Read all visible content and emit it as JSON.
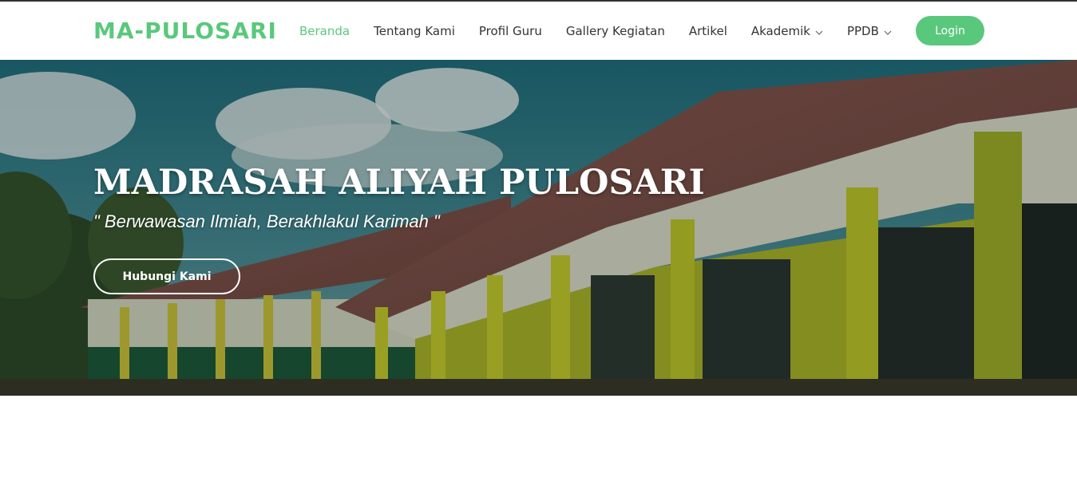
{
  "brand": {
    "logo": "MA-PULOSARI",
    "accent_color": "#5ac87c"
  },
  "nav": {
    "items": [
      {
        "label": "Beranda",
        "active": true
      },
      {
        "label": "Tentang Kami"
      },
      {
        "label": "Profil Guru"
      },
      {
        "label": "Gallery Kegiatan"
      },
      {
        "label": "Artikel"
      },
      {
        "label": "Akademik",
        "icon": "chevron-down-icon"
      },
      {
        "label": "PPDB",
        "icon": "chevron-down-icon"
      }
    ],
    "login_label": "Login"
  },
  "hero": {
    "title": "MADRASAH ALIYAH PULOSARI",
    "subtitle": "\" Berwawasan Ilmiah, Berakhlakul Karimah \"",
    "button_label": "Hubungi Kami"
  }
}
